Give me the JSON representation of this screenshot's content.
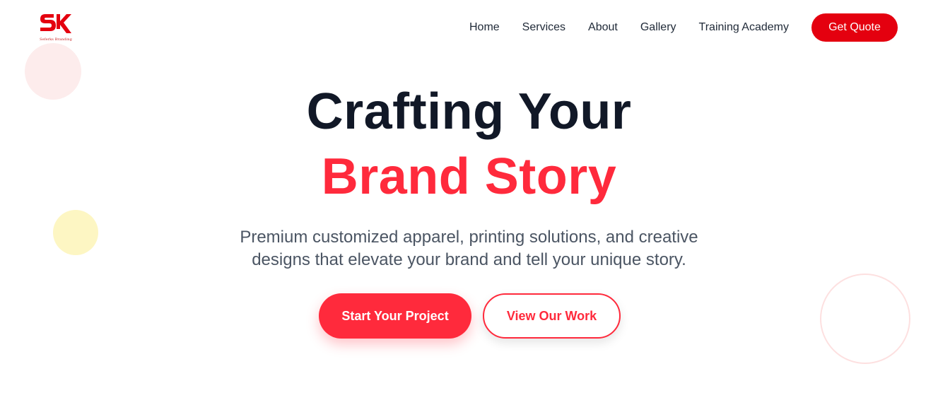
{
  "brand": {
    "logo_icon": "sk-logo-icon",
    "tagline": "Seferks Branding",
    "color": "#e4000f"
  },
  "nav": {
    "items": [
      {
        "label": "Home"
      },
      {
        "label": "Services"
      },
      {
        "label": "About"
      },
      {
        "label": "Gallery"
      },
      {
        "label": "Training Academy"
      }
    ],
    "cta_label": "Get Quote"
  },
  "hero": {
    "title_line1": "Crafting Your",
    "title_line2": "Brand Story",
    "subtitle_line1": "Premium customized apparel, printing solutions, and creative",
    "subtitle_line2": "designs that elevate your brand and tell your unique story.",
    "primary_cta": "Start Your Project",
    "secondary_cta": "View Our Work"
  },
  "colors": {
    "accent": "#ff2a3c",
    "brand_red": "#e4000f",
    "heading": "#111827",
    "body_text": "#4b5563"
  }
}
